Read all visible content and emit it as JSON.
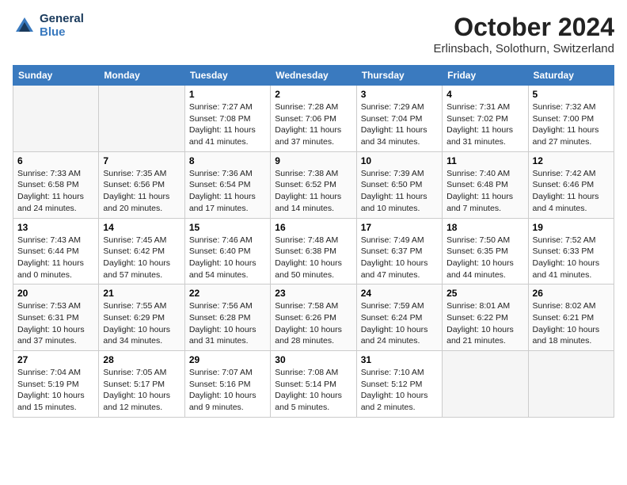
{
  "header": {
    "logo_line1": "General",
    "logo_line2": "Blue",
    "month": "October 2024",
    "location": "Erlinsbach, Solothurn, Switzerland"
  },
  "days_of_week": [
    "Sunday",
    "Monday",
    "Tuesday",
    "Wednesday",
    "Thursday",
    "Friday",
    "Saturday"
  ],
  "weeks": [
    [
      {
        "day": "",
        "empty": true
      },
      {
        "day": "",
        "empty": true
      },
      {
        "day": "1",
        "sunrise": "7:27 AM",
        "sunset": "7:08 PM",
        "daylight": "11 hours and 41 minutes."
      },
      {
        "day": "2",
        "sunrise": "7:28 AM",
        "sunset": "7:06 PM",
        "daylight": "11 hours and 37 minutes."
      },
      {
        "day": "3",
        "sunrise": "7:29 AM",
        "sunset": "7:04 PM",
        "daylight": "11 hours and 34 minutes."
      },
      {
        "day": "4",
        "sunrise": "7:31 AM",
        "sunset": "7:02 PM",
        "daylight": "11 hours and 31 minutes."
      },
      {
        "day": "5",
        "sunrise": "7:32 AM",
        "sunset": "7:00 PM",
        "daylight": "11 hours and 27 minutes."
      }
    ],
    [
      {
        "day": "6",
        "sunrise": "7:33 AM",
        "sunset": "6:58 PM",
        "daylight": "11 hours and 24 minutes."
      },
      {
        "day": "7",
        "sunrise": "7:35 AM",
        "sunset": "6:56 PM",
        "daylight": "11 hours and 20 minutes."
      },
      {
        "day": "8",
        "sunrise": "7:36 AM",
        "sunset": "6:54 PM",
        "daylight": "11 hours and 17 minutes."
      },
      {
        "day": "9",
        "sunrise": "7:38 AM",
        "sunset": "6:52 PM",
        "daylight": "11 hours and 14 minutes."
      },
      {
        "day": "10",
        "sunrise": "7:39 AM",
        "sunset": "6:50 PM",
        "daylight": "11 hours and 10 minutes."
      },
      {
        "day": "11",
        "sunrise": "7:40 AM",
        "sunset": "6:48 PM",
        "daylight": "11 hours and 7 minutes."
      },
      {
        "day": "12",
        "sunrise": "7:42 AM",
        "sunset": "6:46 PM",
        "daylight": "11 hours and 4 minutes."
      }
    ],
    [
      {
        "day": "13",
        "sunrise": "7:43 AM",
        "sunset": "6:44 PM",
        "daylight": "11 hours and 0 minutes."
      },
      {
        "day": "14",
        "sunrise": "7:45 AM",
        "sunset": "6:42 PM",
        "daylight": "10 hours and 57 minutes."
      },
      {
        "day": "15",
        "sunrise": "7:46 AM",
        "sunset": "6:40 PM",
        "daylight": "10 hours and 54 minutes."
      },
      {
        "day": "16",
        "sunrise": "7:48 AM",
        "sunset": "6:38 PM",
        "daylight": "10 hours and 50 minutes."
      },
      {
        "day": "17",
        "sunrise": "7:49 AM",
        "sunset": "6:37 PM",
        "daylight": "10 hours and 47 minutes."
      },
      {
        "day": "18",
        "sunrise": "7:50 AM",
        "sunset": "6:35 PM",
        "daylight": "10 hours and 44 minutes."
      },
      {
        "day": "19",
        "sunrise": "7:52 AM",
        "sunset": "6:33 PM",
        "daylight": "10 hours and 41 minutes."
      }
    ],
    [
      {
        "day": "20",
        "sunrise": "7:53 AM",
        "sunset": "6:31 PM",
        "daylight": "10 hours and 37 minutes."
      },
      {
        "day": "21",
        "sunrise": "7:55 AM",
        "sunset": "6:29 PM",
        "daylight": "10 hours and 34 minutes."
      },
      {
        "day": "22",
        "sunrise": "7:56 AM",
        "sunset": "6:28 PM",
        "daylight": "10 hours and 31 minutes."
      },
      {
        "day": "23",
        "sunrise": "7:58 AM",
        "sunset": "6:26 PM",
        "daylight": "10 hours and 28 minutes."
      },
      {
        "day": "24",
        "sunrise": "7:59 AM",
        "sunset": "6:24 PM",
        "daylight": "10 hours and 24 minutes."
      },
      {
        "day": "25",
        "sunrise": "8:01 AM",
        "sunset": "6:22 PM",
        "daylight": "10 hours and 21 minutes."
      },
      {
        "day": "26",
        "sunrise": "8:02 AM",
        "sunset": "6:21 PM",
        "daylight": "10 hours and 18 minutes."
      }
    ],
    [
      {
        "day": "27",
        "sunrise": "7:04 AM",
        "sunset": "5:19 PM",
        "daylight": "10 hours and 15 minutes."
      },
      {
        "day": "28",
        "sunrise": "7:05 AM",
        "sunset": "5:17 PM",
        "daylight": "10 hours and 12 minutes."
      },
      {
        "day": "29",
        "sunrise": "7:07 AM",
        "sunset": "5:16 PM",
        "daylight": "10 hours and 9 minutes."
      },
      {
        "day": "30",
        "sunrise": "7:08 AM",
        "sunset": "5:14 PM",
        "daylight": "10 hours and 5 minutes."
      },
      {
        "day": "31",
        "sunrise": "7:10 AM",
        "sunset": "5:12 PM",
        "daylight": "10 hours and 2 minutes."
      },
      {
        "day": "",
        "empty": true
      },
      {
        "day": "",
        "empty": true
      }
    ]
  ],
  "labels": {
    "sunrise": "Sunrise:",
    "sunset": "Sunset:",
    "daylight": "Daylight:"
  }
}
